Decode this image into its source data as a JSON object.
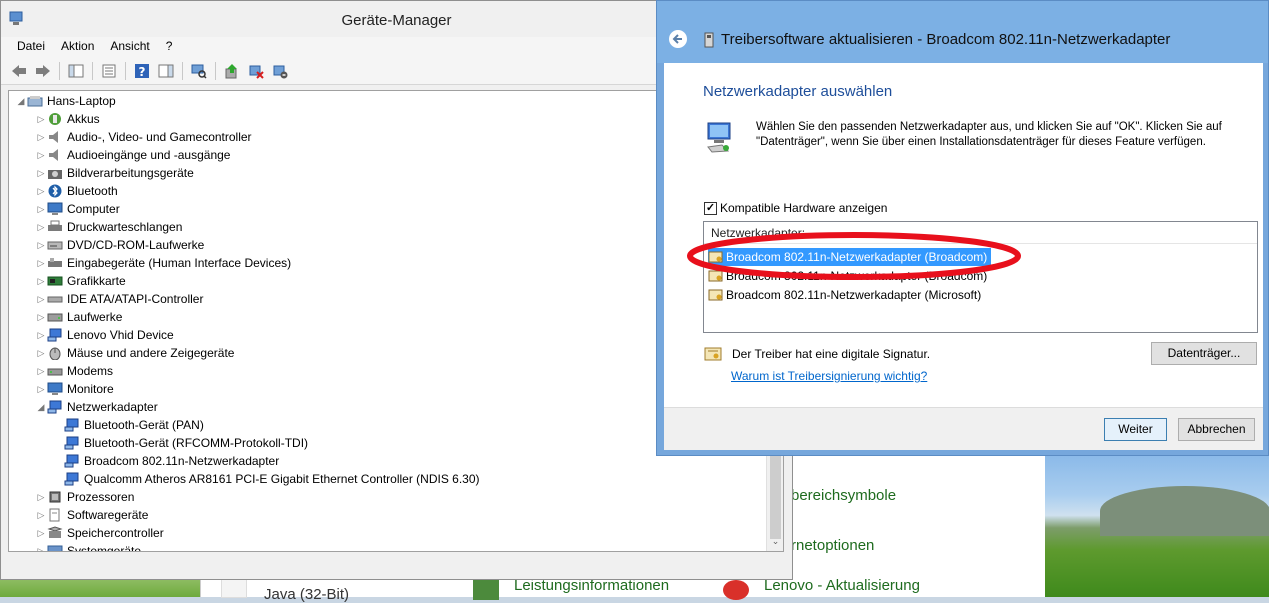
{
  "background": {
    "texts": [
      "bereichsymbole",
      "rnetoptionen",
      "Java (32-Bit)",
      "Leistungsinformationen",
      "Lenovo - Aktualisierung"
    ]
  },
  "device_manager": {
    "title": "Geräte-Manager",
    "menu": [
      "Datei",
      "Aktion",
      "Ansicht",
      "?"
    ],
    "tree": [
      {
        "label": "Hans-Laptop",
        "level": 0,
        "expander": "◢",
        "icon": "computer-icon"
      },
      {
        "label": "Akkus",
        "level": 1,
        "expander": "▷",
        "icon": "battery-icon"
      },
      {
        "label": "Audio-, Video- und Gamecontroller",
        "level": 1,
        "expander": "▷",
        "icon": "speaker-icon"
      },
      {
        "label": "Audioeingänge und -ausgänge",
        "level": 1,
        "expander": "▷",
        "icon": "speaker-icon"
      },
      {
        "label": "Bildverarbeitungsgeräte",
        "level": 1,
        "expander": "▷",
        "icon": "camera-icon"
      },
      {
        "label": "Bluetooth",
        "level": 1,
        "expander": "▷",
        "icon": "bluetooth-icon"
      },
      {
        "label": "Computer",
        "level": 1,
        "expander": "▷",
        "icon": "monitor-icon"
      },
      {
        "label": "Druckwarteschlangen",
        "level": 1,
        "expander": "▷",
        "icon": "printer-icon"
      },
      {
        "label": "DVD/CD-ROM-Laufwerke",
        "level": 1,
        "expander": "▷",
        "icon": "disc-drive-icon"
      },
      {
        "label": "Eingabegeräte (Human Interface Devices)",
        "level": 1,
        "expander": "▷",
        "icon": "hid-icon"
      },
      {
        "label": "Grafikkarte",
        "level": 1,
        "expander": "▷",
        "icon": "display-adapter-icon"
      },
      {
        "label": "IDE ATA/ATAPI-Controller",
        "level": 1,
        "expander": "▷",
        "icon": "controller-icon"
      },
      {
        "label": "Laufwerke",
        "level": 1,
        "expander": "▷",
        "icon": "drive-icon"
      },
      {
        "label": "Lenovo Vhid Device",
        "level": 1,
        "expander": "▷",
        "icon": "network-icon"
      },
      {
        "label": "Mäuse und andere Zeigegeräte",
        "level": 1,
        "expander": "▷",
        "icon": "mouse-icon"
      },
      {
        "label": "Modems",
        "level": 1,
        "expander": "▷",
        "icon": "modem-icon"
      },
      {
        "label": "Monitore",
        "level": 1,
        "expander": "▷",
        "icon": "monitor-icon"
      },
      {
        "label": "Netzwerkadapter",
        "level": 1,
        "expander": "◢",
        "icon": "network-icon"
      },
      {
        "label": "Bluetooth-Gerät (PAN)",
        "level": 2,
        "expander": "",
        "icon": "network-icon"
      },
      {
        "label": "Bluetooth-Gerät (RFCOMM-Protokoll-TDI)",
        "level": 2,
        "expander": "",
        "icon": "network-icon"
      },
      {
        "label": "Broadcom 802.11n-Netzwerkadapter",
        "level": 2,
        "expander": "",
        "icon": "network-icon"
      },
      {
        "label": "Qualcomm Atheros AR8161 PCI-E Gigabit Ethernet Controller (NDIS 6.30)",
        "level": 2,
        "expander": "",
        "icon": "network-icon"
      },
      {
        "label": "Prozessoren",
        "level": 1,
        "expander": "▷",
        "icon": "processor-icon"
      },
      {
        "label": "Softwaregeräte",
        "level": 1,
        "expander": "▷",
        "icon": "software-device-icon"
      },
      {
        "label": "Speichercontroller",
        "level": 1,
        "expander": "▷",
        "icon": "storage-icon"
      },
      {
        "label": "Systemgeräte",
        "level": 1,
        "expander": "▷",
        "icon": "system-icon"
      }
    ]
  },
  "wizard": {
    "title": "Treibersoftware aktualisieren - Broadcom 802.11n-Netzwerkadapter",
    "heading": "Netzwerkadapter auswählen",
    "description": "Wählen Sie den passenden Netzwerkadapter aus, und klicken Sie auf \"OK\". Klicken Sie auf \"Datenträger\", wenn Sie über einen Installationsdatenträger für dieses Feature verfügen.",
    "checkbox_label": "Kompatible Hardware anzeigen",
    "checkbox_checked": true,
    "checkbox_mark": "✓",
    "list_header": "Netzwerkadapter:",
    "adapters": [
      {
        "label": "Broadcom 802.11n-Netzwerkadapter (Broadcom)",
        "selected": true
      },
      {
        "label": "Broadcom 802.11n-Netzwerkadapter (Broadcom)",
        "selected": false
      },
      {
        "label": "Broadcom 802.11n-Netzwerkadapter (Microsoft)",
        "selected": false
      }
    ],
    "signature_text": "Der Treiber hat eine digitale Signatur.",
    "signature_link": "Warum ist Treibersignierung wichtig?",
    "disk_button": "Datenträger...",
    "next_button": "Weiter",
    "cancel_button": "Abbrechen",
    "highlight_color": "#e8101c"
  }
}
